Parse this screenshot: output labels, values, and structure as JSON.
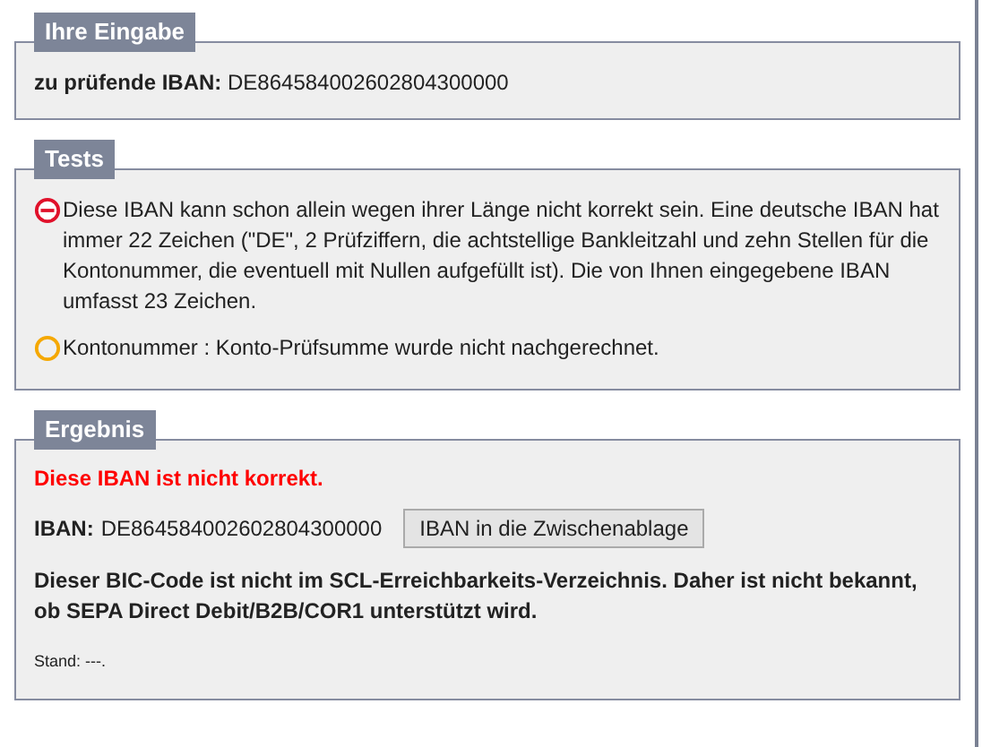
{
  "input": {
    "title": "Ihre Eingabe",
    "label": "zu prüfende IBAN:",
    "value": "DE864584002602804300000"
  },
  "tests": {
    "title": "Tests",
    "items": [
      {
        "kind": "error",
        "text": "Diese IBAN kann schon allein wegen ihrer Länge nicht korrekt sein. Eine deutsche IBAN hat immer 22 Zeichen (\"DE\", 2 Prüfziffern, die achtstellige Bankleitzahl und zehn Stellen für die Kontonummer, die eventuell mit Nullen aufgefüllt ist). Die von Ihnen eingegebene IBAN umfasst 23 Zeichen."
      },
      {
        "kind": "warning",
        "text": "Kontonummer : Konto-Prüfsumme wurde nicht nachgerechnet."
      }
    ]
  },
  "result": {
    "title": "Ergebnis",
    "verdict": "Diese IBAN ist nicht korrekt.",
    "iban_label": "IBAN:",
    "iban_value": "DE864584002602804300000",
    "copy_button": "IBAN in die Zwischenablage",
    "bic_note": "Dieser BIC-Code ist nicht im SCL-Erreichbarkeits-Verzeichnis. Daher ist nicht bekannt, ob SEPA Direct Debit/B2B/COR1 unterstützt wird.",
    "stand": "Stand: ---."
  }
}
